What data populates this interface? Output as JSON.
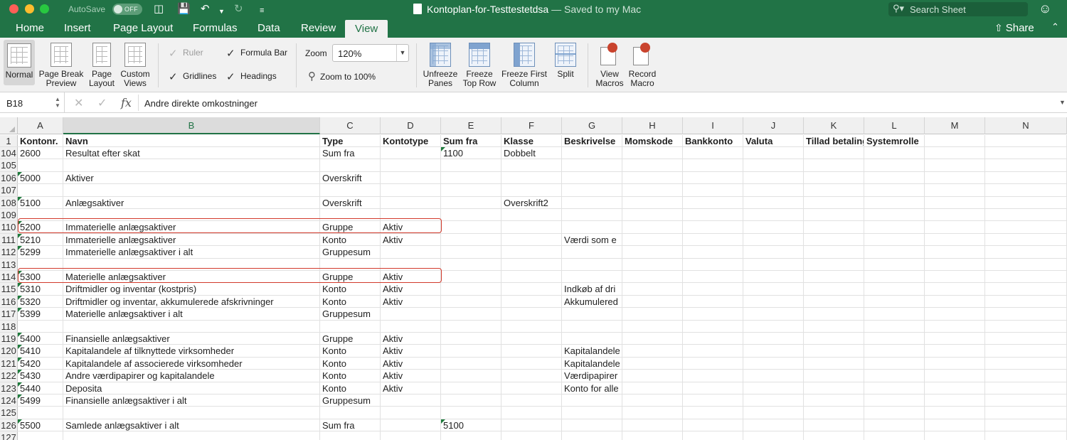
{
  "titlebar": {
    "autosave_label": "AutoSave",
    "autosave_state": "OFF",
    "file_name": "Kontoplan-for-Testtestetdsa",
    "saved_status": " — Saved to my Mac",
    "search_placeholder": "Search Sheet"
  },
  "tabs": [
    {
      "label": "Home"
    },
    {
      "label": "Insert"
    },
    {
      "label": "Page Layout"
    },
    {
      "label": "Formulas"
    },
    {
      "label": "Data"
    },
    {
      "label": "Review"
    },
    {
      "label": "View",
      "active": true
    }
  ],
  "share_label": "Share",
  "ribbon": {
    "workbook_views": [
      {
        "line1": "Normal",
        "line2": ""
      },
      {
        "line1": "Page Break",
        "line2": "Preview"
      },
      {
        "line1": "Page",
        "line2": "Layout"
      },
      {
        "line1": "Custom",
        "line2": "Views"
      }
    ],
    "show": {
      "ruler": "Ruler",
      "gridlines": "Gridlines",
      "formula_bar": "Formula Bar",
      "headings": "Headings"
    },
    "zoom_label": "Zoom",
    "zoom_value": "120%",
    "zoom_100": "Zoom to 100%",
    "window": [
      {
        "line1": "Unfreeze",
        "line2": "Panes"
      },
      {
        "line1": "Freeze",
        "line2": "Top Row"
      },
      {
        "line1": "Freeze First",
        "line2": "Column"
      },
      {
        "line1": "Split",
        "line2": ""
      }
    ],
    "macros": [
      {
        "line1": "View",
        "line2": "Macros"
      },
      {
        "line1": "Record",
        "line2": "Macro"
      }
    ]
  },
  "formula_bar": {
    "name_box": "B18",
    "fx": "fx",
    "value": "Andre direkte omkostninger"
  },
  "columns": [
    "A",
    "B",
    "C",
    "D",
    "E",
    "F",
    "G",
    "H",
    "I",
    "J",
    "K",
    "L",
    "M",
    "N"
  ],
  "rows": [
    {
      "num": "1",
      "cells": [
        "Kontonr.",
        "Navn",
        "Type",
        "Kontotype",
        "Sum fra",
        "Klasse",
        "Beskrivelse",
        "Momskode",
        "Bankkonto",
        "Valuta",
        "Tillad betaling",
        "Systemrolle",
        "",
        ""
      ],
      "header": true
    },
    {
      "num": "104",
      "cells": [
        "2600",
        "Resultat efter skat",
        "Sum fra",
        "",
        "1100",
        "Dobbelt",
        "",
        "",
        "",
        "",
        "",
        "",
        "",
        ""
      ]
    },
    {
      "num": "105",
      "cells": [
        "",
        "",
        "",
        "",
        "",
        "",
        "",
        "",
        "",
        "",
        "",
        "",
        "",
        ""
      ]
    },
    {
      "num": "106",
      "cells": [
        "5000",
        "Aktiver",
        "Overskrift",
        "",
        "",
        "",
        "",
        "",
        "",
        "",
        "",
        "",
        "",
        ""
      ]
    },
    {
      "num": "107",
      "cells": [
        "",
        "",
        "",
        "",
        "",
        "",
        "",
        "",
        "",
        "",
        "",
        "",
        "",
        ""
      ]
    },
    {
      "num": "108",
      "cells": [
        "5100",
        "Anlægsaktiver",
        "Overskrift",
        "",
        "",
        "Overskrift2",
        "",
        "",
        "",
        "",
        "",
        "",
        "",
        ""
      ]
    },
    {
      "num": "109",
      "cells": [
        "",
        "",
        "",
        "",
        "",
        "",
        "",
        "",
        "",
        "",
        "",
        "",
        "",
        ""
      ]
    },
    {
      "num": "110",
      "cells": [
        "5200",
        "Immaterielle anlægsaktiver",
        "Gruppe",
        "Aktiv",
        "",
        "",
        "",
        "",
        "",
        "",
        "",
        "",
        "",
        ""
      ]
    },
    {
      "num": "111",
      "cells": [
        "5210",
        "Immaterielle anlægsaktiver",
        "Konto",
        "Aktiv",
        "",
        "",
        "Værdi som e",
        "",
        "",
        "",
        "",
        "",
        "",
        ""
      ]
    },
    {
      "num": "112",
      "cells": [
        "5299",
        "Immaterielle anlægsaktiver i alt",
        "Gruppesum",
        "",
        "",
        "",
        "",
        "",
        "",
        "",
        "",
        "",
        "",
        ""
      ]
    },
    {
      "num": "113",
      "cells": [
        "",
        "",
        "",
        "",
        "",
        "",
        "",
        "",
        "",
        "",
        "",
        "",
        "",
        ""
      ]
    },
    {
      "num": "114",
      "cells": [
        "5300",
        "Materielle anlægsaktiver",
        "Gruppe",
        "Aktiv",
        "",
        "",
        "",
        "",
        "",
        "",
        "",
        "",
        "",
        ""
      ]
    },
    {
      "num": "115",
      "cells": [
        "5310",
        "Driftmidler og inventar (kostpris)",
        "Konto",
        "Aktiv",
        "",
        "",
        "Indkøb af dri",
        "",
        "",
        "",
        "",
        "",
        "",
        ""
      ]
    },
    {
      "num": "116",
      "cells": [
        "5320",
        "Driftmidler og inventar, akkumulerede afskrivninger",
        "Konto",
        "Aktiv",
        "",
        "",
        "Akkumulered",
        "",
        "",
        "",
        "",
        "",
        "",
        ""
      ]
    },
    {
      "num": "117",
      "cells": [
        "5399",
        "Materielle anlægsaktiver i alt",
        "Gruppesum",
        "",
        "",
        "",
        "",
        "",
        "",
        "",
        "",
        "",
        "",
        ""
      ]
    },
    {
      "num": "118",
      "cells": [
        "",
        "",
        "",
        "",
        "",
        "",
        "",
        "",
        "",
        "",
        "",
        "",
        "",
        ""
      ]
    },
    {
      "num": "119",
      "cells": [
        "5400",
        "Finansielle anlægsaktiver",
        "Gruppe",
        "Aktiv",
        "",
        "",
        "",
        "",
        "",
        "",
        "",
        "",
        "",
        ""
      ]
    },
    {
      "num": "120",
      "cells": [
        "5410",
        "Kapitalandele af tilknyttede virksomheder",
        "Konto",
        "Aktiv",
        "",
        "",
        "Kapitalandele",
        "",
        "",
        "",
        "",
        "",
        "",
        ""
      ]
    },
    {
      "num": "121",
      "cells": [
        "5420",
        "Kapitalandele af associerede virksomheder",
        "Konto",
        "Aktiv",
        "",
        "",
        "Kapitalandele",
        "",
        "",
        "",
        "",
        "",
        "",
        ""
      ]
    },
    {
      "num": "122",
      "cells": [
        "5430",
        "Andre værdipapirer og kapitalandele",
        "Konto",
        "Aktiv",
        "",
        "",
        "Værdipapirer",
        "",
        "",
        "",
        "",
        "",
        "",
        ""
      ]
    },
    {
      "num": "123",
      "cells": [
        "5440",
        "Deposita",
        "Konto",
        "Aktiv",
        "",
        "",
        "Konto for alle",
        "",
        "",
        "",
        "",
        "",
        "",
        ""
      ]
    },
    {
      "num": "124",
      "cells": [
        "5499",
        "Finansielle anlægsaktiver i alt",
        "Gruppesum",
        "",
        "",
        "",
        "",
        "",
        "",
        "",
        "",
        "",
        "",
        ""
      ]
    },
    {
      "num": "125",
      "cells": [
        "",
        "",
        "",
        "",
        "",
        "",
        "",
        "",
        "",
        "",
        "",
        "",
        "",
        ""
      ]
    },
    {
      "num": "126",
      "cells": [
        "5500",
        "Samlede anlægsaktiver i alt",
        "Sum fra",
        "",
        "5100",
        "",
        "",
        "",
        "",
        "",
        "",
        "",
        "",
        ""
      ]
    },
    {
      "num": "127",
      "cells": [
        "",
        "",
        "",
        "",
        "",
        "",
        "",
        "",
        "",
        "",
        "",
        "",
        "",
        ""
      ]
    }
  ],
  "colors": {
    "accent": "#217346",
    "highlight": "#d23a2c",
    "flag": "#1e7b3c"
  },
  "icons": {
    "autosave": "toggle-icon",
    "sidebar": "sidebar-icon",
    "save": "save-icon",
    "undo": "undo-icon",
    "redo": "redo-icon",
    "customize": "customize-icon",
    "search": "search-icon",
    "feedback": "smiley-icon",
    "share": "share-icon",
    "zoom": "magnifier-icon"
  }
}
